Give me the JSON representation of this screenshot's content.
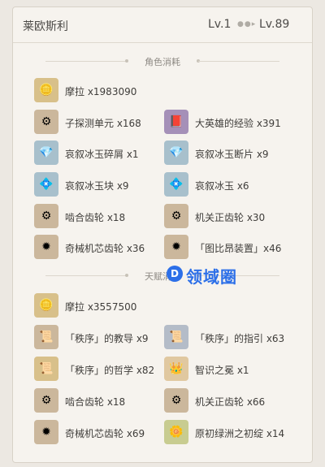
{
  "header": {
    "character_name": "莱欧斯利",
    "level_from": "Lv.1",
    "level_to": "Lv.89"
  },
  "sections": {
    "character": {
      "title": "角色消耗"
    },
    "talent": {
      "title": "天赋消耗"
    }
  },
  "character_items": [
    {
      "label": "摩拉 x1983090",
      "icon": "mora-icon"
    },
    {
      "label": "子探测单元 x168",
      "icon": "sub-detector-unit-icon"
    },
    {
      "label": "大英雄的经验 x391",
      "icon": "heros-wit-icon"
    },
    {
      "label": "哀叙冰玉碎屑 x1",
      "icon": "ice-jade-sliver-icon"
    },
    {
      "label": "哀叙冰玉断片 x9",
      "icon": "ice-jade-fragment-icon"
    },
    {
      "label": "哀叙冰玉块 x9",
      "icon": "ice-jade-chunk-icon"
    },
    {
      "label": "哀叙冰玉 x6",
      "icon": "ice-jade-gemstone-icon"
    },
    {
      "label": "啮合齿轮 x18",
      "icon": "meshing-gear-icon"
    },
    {
      "label": "机关正齿轮 x30",
      "icon": "mechanical-spur-gear-icon"
    },
    {
      "label": "奇械机芯齿轮 x36",
      "icon": "artificed-gear-icon"
    },
    {
      "label": "「图比昂装置」x46",
      "icon": "tourbillon-device-icon"
    }
  ],
  "talent_items": [
    {
      "label": "摩拉 x3557500",
      "icon": "mora-icon"
    },
    {
      "label": "「秩序」的教导 x9",
      "icon": "teachings-of-order-icon"
    },
    {
      "label": "「秩序」的指引 x63",
      "icon": "guide-to-order-icon"
    },
    {
      "label": "「秩序」的哲学 x82",
      "icon": "philosophies-of-order-icon"
    },
    {
      "label": "智识之冕 x1",
      "icon": "crown-of-insight-icon"
    },
    {
      "label": "啮合齿轮 x18",
      "icon": "meshing-gear-icon"
    },
    {
      "label": "机关正齿轮 x66",
      "icon": "mechanical-spur-gear-icon"
    },
    {
      "label": "奇械机芯齿轮 x69",
      "icon": "artificed-gear-icon"
    },
    {
      "label": "原初绿洲之初绽 x14",
      "icon": "primordial-greenbloom-icon"
    }
  ],
  "watermark": {
    "logo_letter": "D",
    "text": "领域圈"
  },
  "colors": {
    "accent": "#2c6fe8",
    "icon_bg": "#cbb79c",
    "panel_bg": "#f6f3ee"
  }
}
